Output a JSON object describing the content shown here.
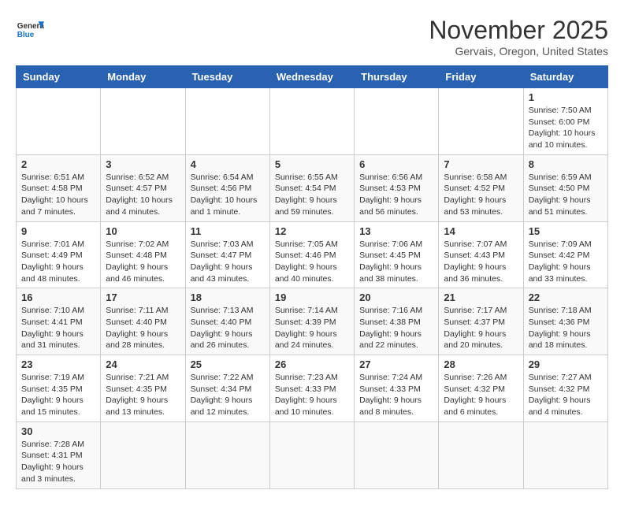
{
  "header": {
    "logo_general": "General",
    "logo_blue": "Blue",
    "month_title": "November 2025",
    "location": "Gervais, Oregon, United States"
  },
  "days_of_week": [
    "Sunday",
    "Monday",
    "Tuesday",
    "Wednesday",
    "Thursday",
    "Friday",
    "Saturday"
  ],
  "weeks": [
    [
      {
        "day": "",
        "info": ""
      },
      {
        "day": "",
        "info": ""
      },
      {
        "day": "",
        "info": ""
      },
      {
        "day": "",
        "info": ""
      },
      {
        "day": "",
        "info": ""
      },
      {
        "day": "",
        "info": ""
      },
      {
        "day": "1",
        "info": "Sunrise: 7:50 AM\nSunset: 6:00 PM\nDaylight: 10 hours and 10 minutes."
      }
    ],
    [
      {
        "day": "2",
        "info": "Sunrise: 6:51 AM\nSunset: 4:58 PM\nDaylight: 10 hours and 7 minutes."
      },
      {
        "day": "3",
        "info": "Sunrise: 6:52 AM\nSunset: 4:57 PM\nDaylight: 10 hours and 4 minutes."
      },
      {
        "day": "4",
        "info": "Sunrise: 6:54 AM\nSunset: 4:56 PM\nDaylight: 10 hours and 1 minute."
      },
      {
        "day": "5",
        "info": "Sunrise: 6:55 AM\nSunset: 4:54 PM\nDaylight: 9 hours and 59 minutes."
      },
      {
        "day": "6",
        "info": "Sunrise: 6:56 AM\nSunset: 4:53 PM\nDaylight: 9 hours and 56 minutes."
      },
      {
        "day": "7",
        "info": "Sunrise: 6:58 AM\nSunset: 4:52 PM\nDaylight: 9 hours and 53 minutes."
      },
      {
        "day": "8",
        "info": "Sunrise: 6:59 AM\nSunset: 4:50 PM\nDaylight: 9 hours and 51 minutes."
      }
    ],
    [
      {
        "day": "9",
        "info": "Sunrise: 7:01 AM\nSunset: 4:49 PM\nDaylight: 9 hours and 48 minutes."
      },
      {
        "day": "10",
        "info": "Sunrise: 7:02 AM\nSunset: 4:48 PM\nDaylight: 9 hours and 46 minutes."
      },
      {
        "day": "11",
        "info": "Sunrise: 7:03 AM\nSunset: 4:47 PM\nDaylight: 9 hours and 43 minutes."
      },
      {
        "day": "12",
        "info": "Sunrise: 7:05 AM\nSunset: 4:46 PM\nDaylight: 9 hours and 40 minutes."
      },
      {
        "day": "13",
        "info": "Sunrise: 7:06 AM\nSunset: 4:45 PM\nDaylight: 9 hours and 38 minutes."
      },
      {
        "day": "14",
        "info": "Sunrise: 7:07 AM\nSunset: 4:43 PM\nDaylight: 9 hours and 36 minutes."
      },
      {
        "day": "15",
        "info": "Sunrise: 7:09 AM\nSunset: 4:42 PM\nDaylight: 9 hours and 33 minutes."
      }
    ],
    [
      {
        "day": "16",
        "info": "Sunrise: 7:10 AM\nSunset: 4:41 PM\nDaylight: 9 hours and 31 minutes."
      },
      {
        "day": "17",
        "info": "Sunrise: 7:11 AM\nSunset: 4:40 PM\nDaylight: 9 hours and 28 minutes."
      },
      {
        "day": "18",
        "info": "Sunrise: 7:13 AM\nSunset: 4:40 PM\nDaylight: 9 hours and 26 minutes."
      },
      {
        "day": "19",
        "info": "Sunrise: 7:14 AM\nSunset: 4:39 PM\nDaylight: 9 hours and 24 minutes."
      },
      {
        "day": "20",
        "info": "Sunrise: 7:16 AM\nSunset: 4:38 PM\nDaylight: 9 hours and 22 minutes."
      },
      {
        "day": "21",
        "info": "Sunrise: 7:17 AM\nSunset: 4:37 PM\nDaylight: 9 hours and 20 minutes."
      },
      {
        "day": "22",
        "info": "Sunrise: 7:18 AM\nSunset: 4:36 PM\nDaylight: 9 hours and 18 minutes."
      }
    ],
    [
      {
        "day": "23",
        "info": "Sunrise: 7:19 AM\nSunset: 4:35 PM\nDaylight: 9 hours and 15 minutes."
      },
      {
        "day": "24",
        "info": "Sunrise: 7:21 AM\nSunset: 4:35 PM\nDaylight: 9 hours and 13 minutes."
      },
      {
        "day": "25",
        "info": "Sunrise: 7:22 AM\nSunset: 4:34 PM\nDaylight: 9 hours and 12 minutes."
      },
      {
        "day": "26",
        "info": "Sunrise: 7:23 AM\nSunset: 4:33 PM\nDaylight: 9 hours and 10 minutes."
      },
      {
        "day": "27",
        "info": "Sunrise: 7:24 AM\nSunset: 4:33 PM\nDaylight: 9 hours and 8 minutes."
      },
      {
        "day": "28",
        "info": "Sunrise: 7:26 AM\nSunset: 4:32 PM\nDaylight: 9 hours and 6 minutes."
      },
      {
        "day": "29",
        "info": "Sunrise: 7:27 AM\nSunset: 4:32 PM\nDaylight: 9 hours and 4 minutes."
      }
    ],
    [
      {
        "day": "30",
        "info": "Sunrise: 7:28 AM\nSunset: 4:31 PM\nDaylight: 9 hours and 3 minutes."
      },
      {
        "day": "",
        "info": ""
      },
      {
        "day": "",
        "info": ""
      },
      {
        "day": "",
        "info": ""
      },
      {
        "day": "",
        "info": ""
      },
      {
        "day": "",
        "info": ""
      },
      {
        "day": "",
        "info": ""
      }
    ]
  ]
}
